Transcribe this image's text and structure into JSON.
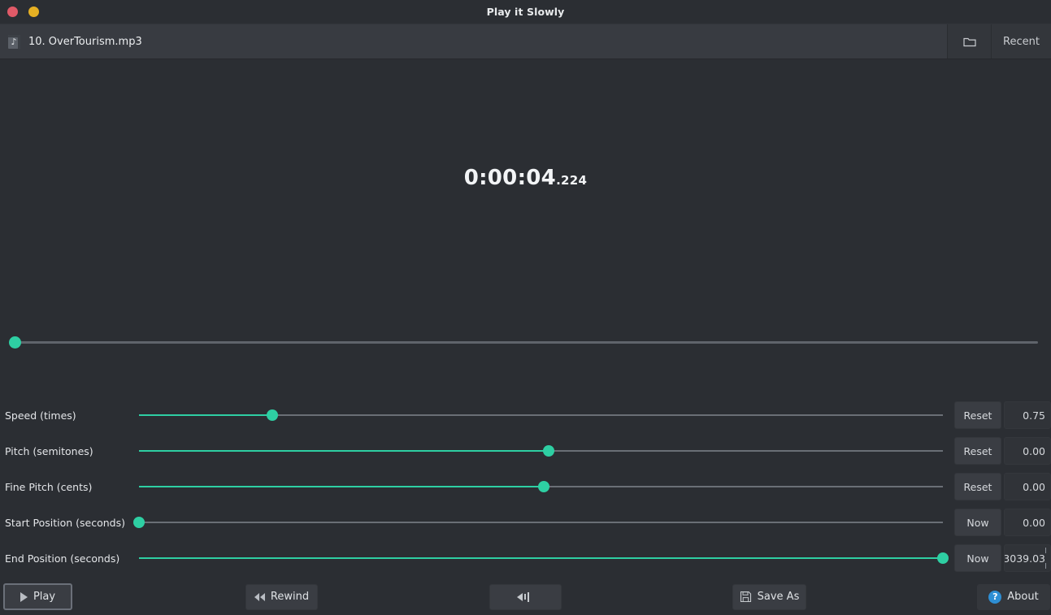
{
  "window": {
    "title": "Play it Slowly",
    "close_label": "",
    "minimize_label": ""
  },
  "filebar": {
    "file_name": "10. OverTourism.mp3",
    "file_icon": "music-file-icon",
    "folder_label": "",
    "recent_label": "Recent"
  },
  "player": {
    "time_main": "0:00:04",
    "time_ms": ".224",
    "seek_position_percent": 0
  },
  "controls": [
    {
      "label": "Speed (times)",
      "button_label": "Reset",
      "value": "0.75",
      "fill_percent": 16.6,
      "handle_percent": 16.6,
      "spin": false
    },
    {
      "label": "Pitch (semitones)",
      "button_label": "Reset",
      "value": "0.00",
      "fill_percent": 51.0,
      "handle_percent": 51.0,
      "spin": false
    },
    {
      "label": "Fine Pitch (cents)",
      "button_label": "Reset",
      "value": "0.00",
      "fill_percent": 50.4,
      "handle_percent": 50.4,
      "spin": false
    },
    {
      "label": "Start Position (seconds)",
      "button_label": "Now",
      "value": "0.00",
      "fill_percent": 0,
      "handle_percent": 0,
      "spin": false
    },
    {
      "label": "End Position (seconds)",
      "button_label": "Now",
      "value": "3039.03",
      "fill_percent": 100,
      "handle_percent": 100,
      "spin": true
    }
  ],
  "toolbar": {
    "play_label": "Play",
    "rewind_label": "Rewind",
    "volume_label": "",
    "save_as_label": "Save As",
    "about_label": "About",
    "about_icon_char": "?"
  },
  "colors": {
    "accent": "#2ecfa3",
    "titlebar": "#2b2e33",
    "filebar": "#383b41",
    "body": "#2b2e33",
    "close_dot": "#e05a68",
    "minimize_dot": "#e6b023",
    "about_icon": "#2e8fd4"
  }
}
